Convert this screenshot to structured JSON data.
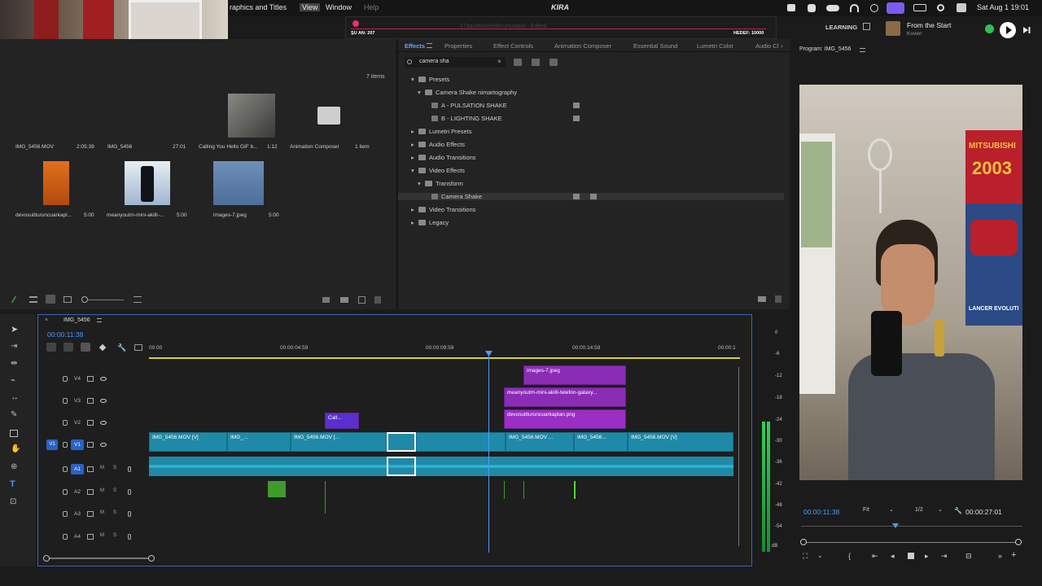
{
  "menubar": {
    "items": [
      "raphics and Titles",
      "View",
      "Window",
      "Help"
    ],
    "stream_title": "KIRA",
    "su_an": "ŞU AN: 207",
    "hedef": "HEDEF: 10000",
    "tab_title": "17agustostelefonunuogun - Edited",
    "date_time": "Sat Aug 1  19:01"
  },
  "learning_label": "LEARNING",
  "now_playing": {
    "title": "From the Start",
    "artist": "Koven"
  },
  "project": {
    "items_count": "7 items",
    "thumbnails": [
      {
        "name": "IMG_5456.MOV",
        "duration": "2:05:39"
      },
      {
        "name": "IMG_5456",
        "duration": "27:01"
      },
      {
        "name": "Calling You Hello GIF b...",
        "duration": "1:12"
      },
      {
        "name": "Animation Composer",
        "duration": "1 item"
      },
      {
        "name": "devosuitturuncuarkapl...",
        "duration": "5:00"
      },
      {
        "name": "meanyoutm-mini-akilli-...",
        "duration": "5:00"
      },
      {
        "name": "images-7.jpeg",
        "duration": "5:00"
      }
    ]
  },
  "effects": {
    "tabs": [
      "Effects",
      "Properties",
      "Effect Controls",
      "Animation Composer",
      "Essential Sound",
      "Lumetri Color",
      "Audio Cl"
    ],
    "search_value": "camera sha",
    "tree": [
      {
        "label": "Presets",
        "indent": 0,
        "open": true
      },
      {
        "label": "Camera Shake nimartography",
        "indent": 1,
        "open": true
      },
      {
        "label": "A - PULSATION SHAKE",
        "indent": 2,
        "leaf": true
      },
      {
        "label": "B - LIGHTING SHAKE",
        "indent": 2,
        "leaf": true
      },
      {
        "label": "Lumetri Presets",
        "indent": 0
      },
      {
        "label": "Audio Effects",
        "indent": 0
      },
      {
        "label": "Audio Transitions",
        "indent": 0
      },
      {
        "label": "Video Effects",
        "indent": 0,
        "open": true
      },
      {
        "label": "Transform",
        "indent": 1,
        "open": true
      },
      {
        "label": "Camera Shake",
        "indent": 2,
        "leaf": true,
        "selected": true
      },
      {
        "label": "Video Transitions",
        "indent": 0
      },
      {
        "label": "Legacy",
        "indent": 0
      }
    ]
  },
  "program": {
    "title": "Program: IMG_5456",
    "timecode": "00:00:11:38",
    "fit": "Fit",
    "resolution": "1/2",
    "duration": "00:00:27:01",
    "poster_text": [
      "MITSUBISHI",
      "2003",
      "LANCER EVOLUTI"
    ]
  },
  "timeline": {
    "sequence_name": "IMG_5456",
    "timecode": "00:00:11:38",
    "ruler": [
      "00:00",
      "00:00:04:59",
      "00:00:09:59",
      "00:00:14:59",
      "00:00:1"
    ],
    "tracks": [
      "V4",
      "V3",
      "V2",
      "V1",
      "A1",
      "A2",
      "A3",
      "A4"
    ],
    "v1_source": "V1",
    "clips_v4": "images-7.jpeg",
    "clips_v3": "meanyoutm-mini-akilli-telefon-galaxy...",
    "clips_v2_png": "devosuitturuncuarkaplan.png",
    "clips_v2_gif": "Call...",
    "v1_clips": [
      "IMG_5456.MOV [V]",
      "IMG_...",
      "IMG_5456.MOV [...",
      "IMG_5456.MOV ...",
      "IMG_5456...",
      "IMG_5456.MOV [V]"
    ],
    "meter_ticks": [
      "0",
      "-6",
      "-12",
      "-18",
      "-24",
      "-30",
      "-36",
      "-42",
      "-48",
      "-54",
      "dB"
    ]
  }
}
